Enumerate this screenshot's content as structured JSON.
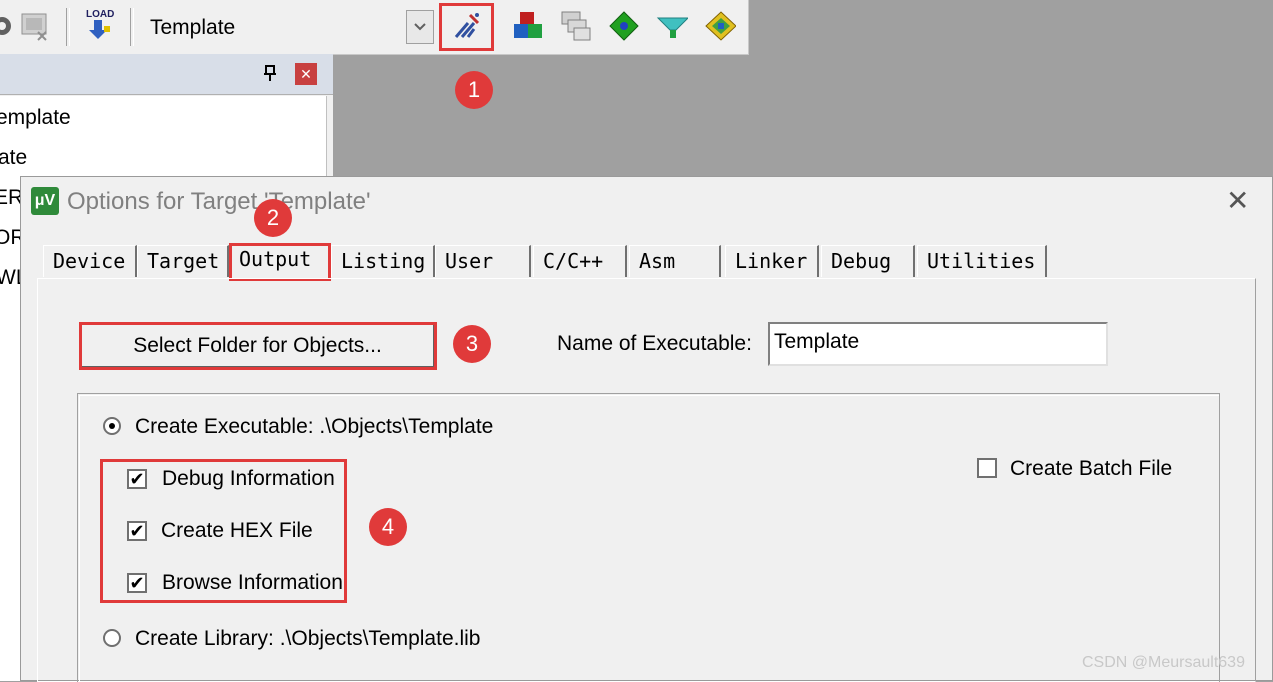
{
  "toolbar": {
    "target_value": "Template",
    "load_label": "LOAD",
    "icons": [
      "gear-icon",
      "batch-build-icon",
      "download-load-icon",
      "options-for-target-icon",
      "pack-installer-icon",
      "window-layout-icon",
      "manage-components-icon",
      "select-software-packs-icon",
      "manage-runtime-env-icon"
    ]
  },
  "panel": {
    "tree": [
      "emplate",
      "ate",
      "ER",
      "OR",
      "WL"
    ]
  },
  "dialog": {
    "title": "Options for Target 'Template'",
    "logo": "μV",
    "close_glyph": "✕",
    "tabs": [
      "Device",
      "Target",
      "Output",
      "Listing",
      "User",
      "C/C++",
      "Asm",
      "Linker",
      "Debug",
      "Utilities"
    ],
    "active_tab": "Output",
    "select_folder_button": "Select Folder for Objects...",
    "name_of_executable_label": "Name of Executable:",
    "name_of_executable_value": "Template",
    "create_executable_label": "Create Executable:  .\\Objects\\Template",
    "debug_information_label": "Debug Information",
    "create_hex_label": "Create HEX File",
    "browse_information_label": "Browse Information",
    "create_batch_label": "Create Batch File",
    "create_library_label": "Create Library:  .\\Objects\\Template.lib",
    "create_executable_selected": true,
    "debug_information_checked": true,
    "create_hex_checked": true,
    "browse_information_checked": true,
    "create_batch_checked": false,
    "check_glyph": "✔"
  },
  "annotations": [
    "1",
    "2",
    "3",
    "4"
  ],
  "watermark": "CSDN @Meursault639",
  "colors": {
    "highlight": "#e03a3a",
    "badge": "#e03a3a"
  }
}
